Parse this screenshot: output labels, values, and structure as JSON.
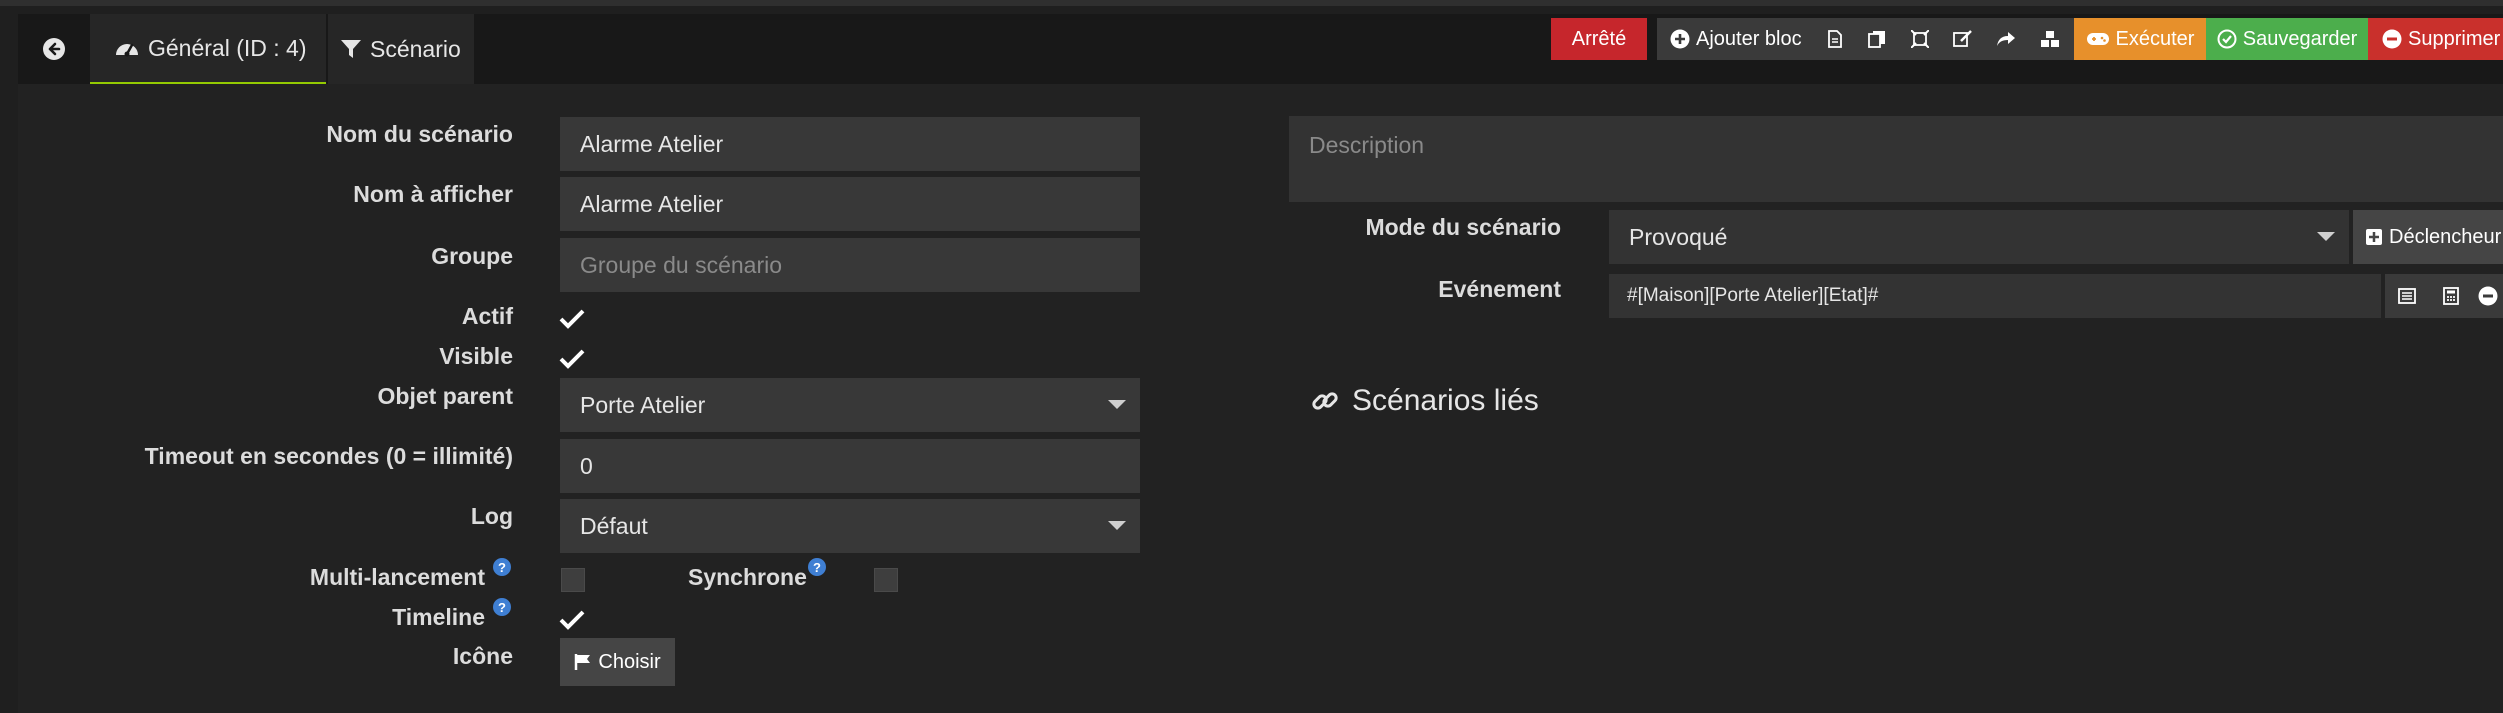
{
  "tabs": {
    "general": "Général (ID : 4)",
    "scenario": "Scénario"
  },
  "toolbar": {
    "state": "Arrêté",
    "add_block": "Ajouter bloc",
    "execute": "Exécuter",
    "save": "Sauvegarder",
    "delete": "Supprimer"
  },
  "form": {
    "name_label": "Nom du scénario",
    "name_value": "Alarme Atelier",
    "display_label": "Nom à afficher",
    "display_value": "Alarme Atelier",
    "group_label": "Groupe",
    "group_placeholder": "Groupe du scénario",
    "active_label": "Actif",
    "visible_label": "Visible",
    "parent_label": "Objet parent",
    "parent_value": "Porte Atelier",
    "timeout_label": "Timeout en secondes (0 = illimité)",
    "timeout_value": "0",
    "log_label": "Log",
    "log_value": "Défaut",
    "multi_label": "Multi-lancement",
    "sync_label": "Synchrone",
    "timeline_label": "Timeline",
    "icon_label": "Icône",
    "choose_button": "Choisir",
    "help_glyph": "?"
  },
  "right": {
    "description_placeholder": "Description",
    "mode_label": "Mode du scénario",
    "mode_value": "Provoqué",
    "trigger_button": "Déclencheur",
    "event_label": "Evénement",
    "event_value": "#[Maison][Porte Atelier][Etat]#",
    "linked_title": "Scénarios liés"
  },
  "states": {
    "active": true,
    "visible": true,
    "multi_launch": false,
    "synchronous": false,
    "timeline": true
  },
  "colors": {
    "state_stopped": "#c6262c",
    "execute": "#e7902b",
    "save": "#4cae4c",
    "delete": "#c9302c",
    "active_tab_underline": "#94ca02"
  }
}
